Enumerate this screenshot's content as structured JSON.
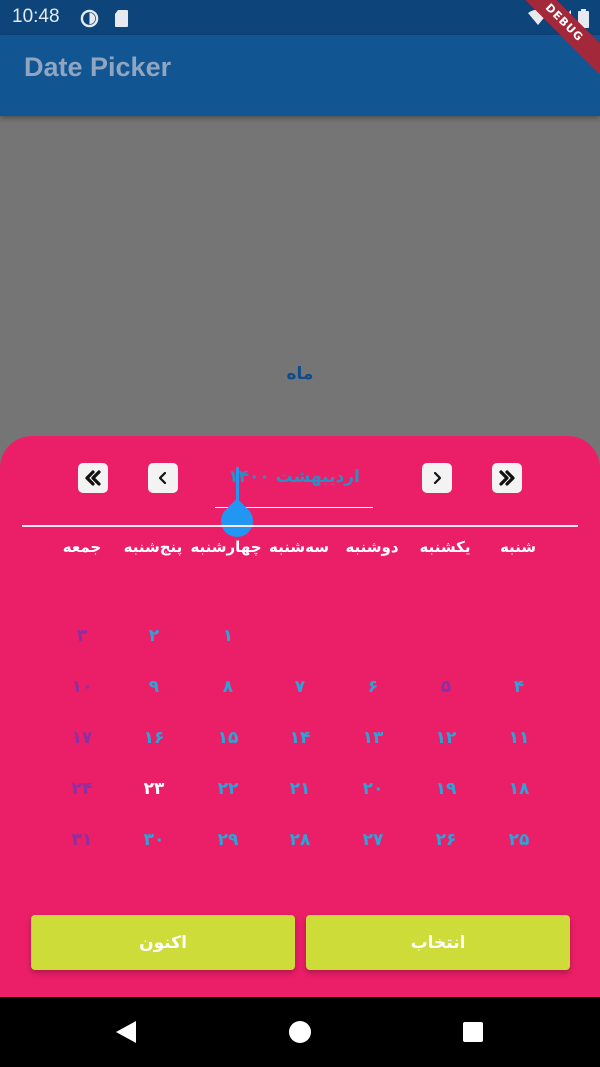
{
  "status_bar": {
    "time": "10:48"
  },
  "app_bar": {
    "title": "Date Picker"
  },
  "debug_banner": "DEBUG",
  "background": {
    "label": "ماه"
  },
  "picker": {
    "month_title": "اردیبهشت ۱۴۰۰",
    "weekdays": [
      "شنبه",
      "یکشنبه",
      "دوشنبه",
      "سه‌شنبه",
      "چهارشنبه",
      "پنج‌شنبه",
      "جمعه"
    ],
    "days": [
      "۱",
      "۲",
      "۳",
      "۴",
      "۵",
      "۶",
      "۷",
      "۸",
      "۹",
      "۱۰",
      "۱۱",
      "۱۲",
      "۱۳",
      "۱۴",
      "۱۵",
      "۱۶",
      "۱۷",
      "۱۸",
      "۱۹",
      "۲۰",
      "۲۱",
      "۲۲",
      "۲۳",
      "۲۴",
      "۲۵",
      "۲۶",
      "۲۷",
      "۲۸",
      "۲۹",
      "۳۰",
      "۳۱"
    ],
    "select_label": "انتخاب",
    "now_label": "اکنون"
  },
  "colors": {
    "sheet": "#eb1f67",
    "day_text": "#2ba5d9",
    "friday_text": "#8a2fa4",
    "button": "#cddc39",
    "app_bar": "#115593"
  }
}
